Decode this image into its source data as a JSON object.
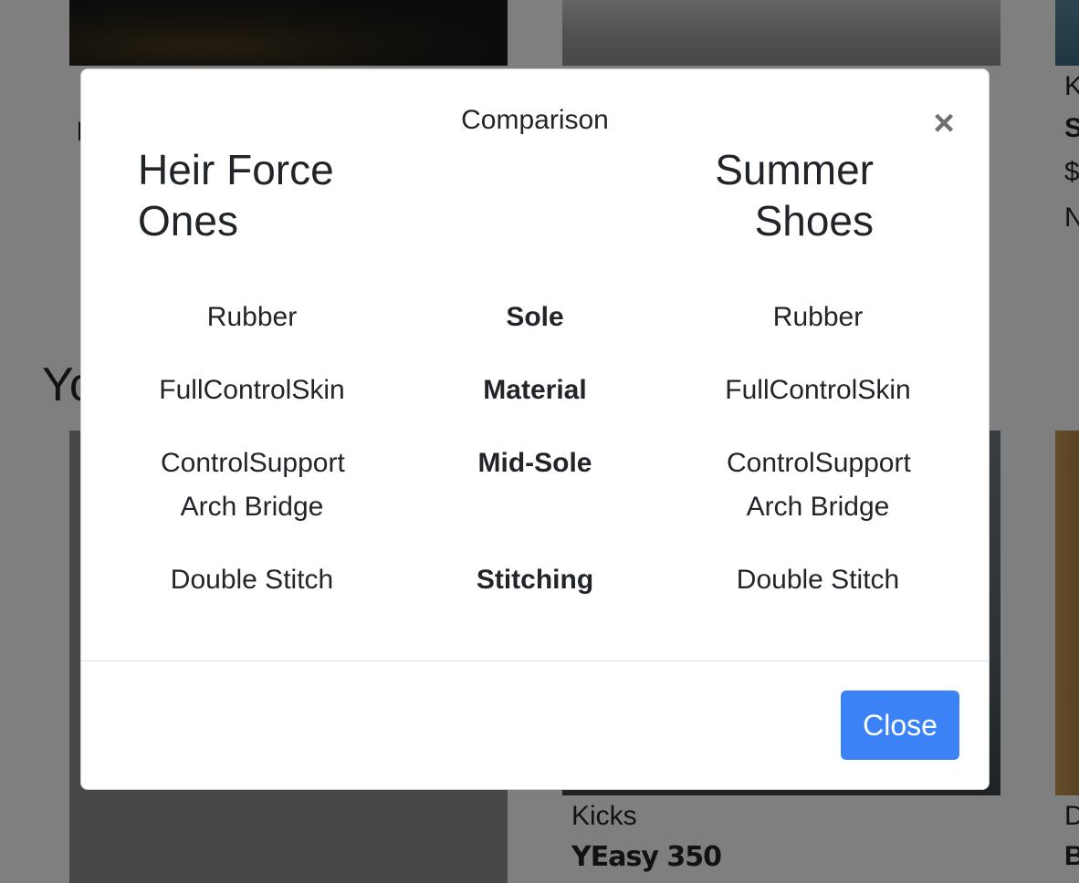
{
  "background": {
    "section_title": "Yo",
    "left_fragment": "I",
    "card_center": {
      "brand": "Kicks",
      "name": "YEasy 350"
    },
    "card_right": {
      "line1": "K",
      "line2": "S",
      "line3": "$",
      "line4": "N",
      "line5": "D",
      "line6": "B"
    }
  },
  "modal": {
    "title": "Comparison",
    "close_icon": "×",
    "left_shoe": "Heir Force Ones",
    "right_shoe": "Summer Shoes",
    "rows": [
      {
        "left": "Rubber",
        "spec": "Sole",
        "right": "Rubber"
      },
      {
        "left": "FullControlSkin",
        "spec": "Material",
        "right": "FullControlSkin"
      },
      {
        "left": "ControlSupport Arch Bridge",
        "spec": "Mid-Sole",
        "right": "ControlSupport Arch Bridge"
      },
      {
        "left": "Double Stitch",
        "spec": "Stitching",
        "right": "Double Stitch"
      }
    ],
    "close_button": "Close"
  },
  "colors": {
    "primary_button": "#3b82f6",
    "backdrop": "rgba(0,0,0,0.5)",
    "text": "#212529"
  }
}
